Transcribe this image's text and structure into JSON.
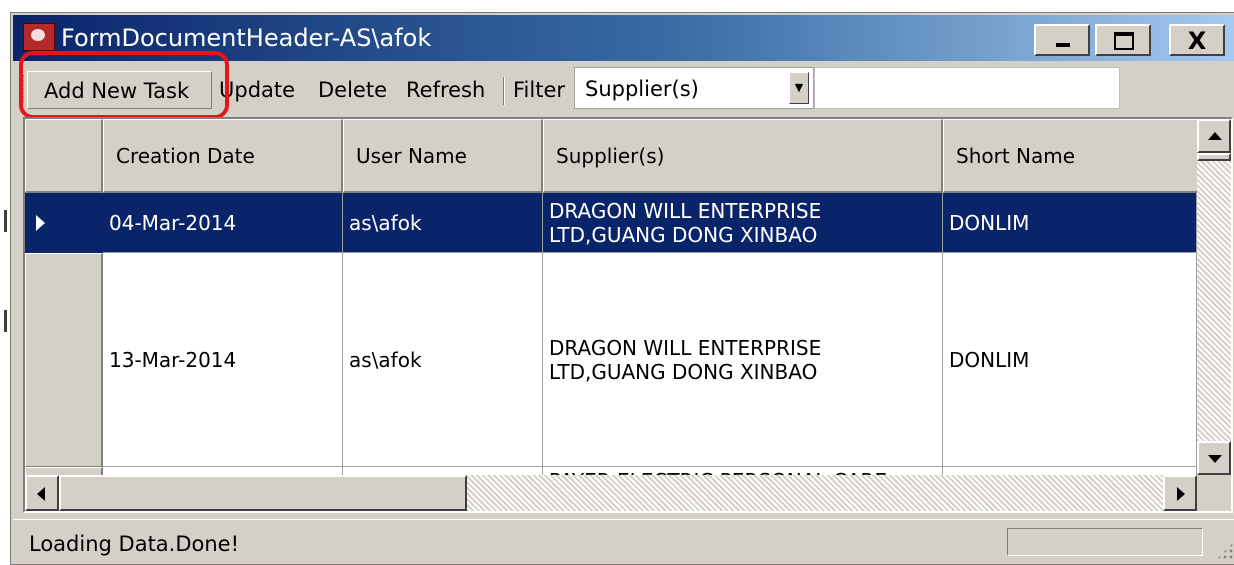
{
  "window": {
    "title": "FormDocumentHeader-AS\\afok",
    "icon": "app-icon",
    "controls": {
      "minimize": "minimize-icon",
      "maximize": "maximize-icon",
      "close_label": "X"
    }
  },
  "toolbar": {
    "add_label": "Add New Task",
    "update_label": "Update",
    "delete_label": "Delete",
    "refresh_label": "Refresh",
    "filter_label": "Filter",
    "filter_value": "Supplier(s)",
    "filter_text": ""
  },
  "grid": {
    "columns": [
      "Creation Date",
      "User Name",
      "Supplier(s)",
      "Short Name"
    ],
    "rows": [
      {
        "creation_date": "04-Mar-2014",
        "user_name": "as\\afok",
        "suppliers": "DRAGON WILL ENTERPRISE\nLTD,GUANG DONG XINBAO",
        "short_name": "DONLIM",
        "selected": true
      },
      {
        "creation_date": "13-Mar-2014",
        "user_name": "as\\afok",
        "suppliers": "DRAGON WILL ENTERPRISE\nLTD,GUANG DONG XINBAO",
        "short_name": "DONLIM",
        "selected": false
      },
      {
        "creation_date": "",
        "user_name": "",
        "suppliers": "PAYER ELECTRIC PERSONAL CARE",
        "short_name": "",
        "selected": false
      }
    ]
  },
  "status": {
    "text": "Loading Data.Done!"
  },
  "colors": {
    "highlight": "#e8141b",
    "selection": "#0a246a",
    "face": "#d4d0c8"
  }
}
